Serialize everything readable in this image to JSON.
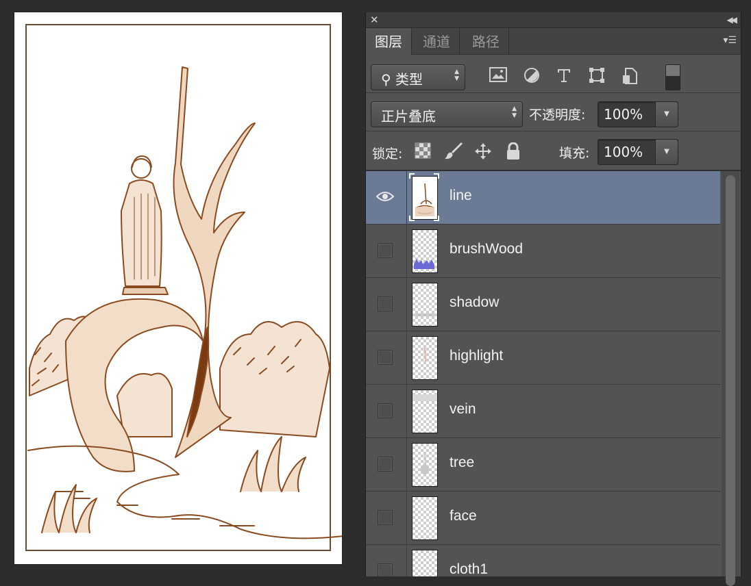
{
  "titlebar": {
    "close_icon": "close-icon",
    "collapse_icon": "collapse-double-chevron-icon"
  },
  "tabs": [
    {
      "label": "图层",
      "active": true
    },
    {
      "label": "通道",
      "active": false
    },
    {
      "label": "路径",
      "active": false
    }
  ],
  "panel_menu_icon": "panel-menu-icon",
  "filter": {
    "kind_label": "类型",
    "icons": [
      "image-filter-icon",
      "adjustment-filter-icon",
      "type-filter-icon",
      "shape-filter-icon",
      "smart-object-filter-icon"
    ],
    "toggle_icon": "filter-toggle-icon"
  },
  "blend": {
    "mode": "正片叠底",
    "opacity_label": "不透明度:",
    "opacity_value": "100%"
  },
  "lock": {
    "label": "锁定:",
    "icons": [
      "lock-transparent-pixels-icon",
      "lock-image-pixels-icon",
      "lock-position-icon",
      "lock-all-icon"
    ],
    "fill_label": "填充:",
    "fill_value": "100%"
  },
  "layers": [
    {
      "name": "line",
      "visible": true,
      "selected": true
    },
    {
      "name": "brushWood",
      "visible": false,
      "selected": false
    },
    {
      "name": "shadow",
      "visible": false,
      "selected": false
    },
    {
      "name": "highlight",
      "visible": false,
      "selected": false
    },
    {
      "name": "vein",
      "visible": false,
      "selected": false
    },
    {
      "name": "tree",
      "visible": false,
      "selected": false
    },
    {
      "name": "face",
      "visible": false,
      "selected": false
    },
    {
      "name": "cloth1",
      "visible": false,
      "selected": false
    }
  ],
  "colors": {
    "ink": "#8a4a1f",
    "selected_row": "#6b7b96",
    "panel_bg": "#535353"
  }
}
